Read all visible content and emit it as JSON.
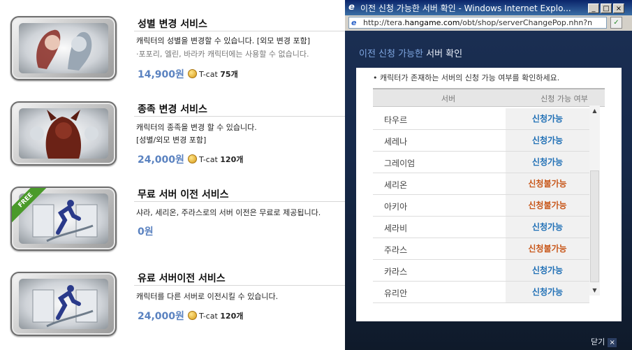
{
  "shop": {
    "items": [
      {
        "title": "성별 변경 서비스",
        "desc1": "캐릭터의 성별을 변경할 수 있습니다. [외모 변경 포함]",
        "desc2": "·포포리, 엘린, 바라카 캐릭터에는 사용할 수 없습니다.",
        "price": "14,900원",
        "tcat_label": "T-cat",
        "tcat_amount": "75개"
      },
      {
        "title": "종족 변경 서비스",
        "desc1": "캐릭터의 종족을 변경 할 수 있습니다.",
        "desc2": "[성별/외모 변경 포함]",
        "price": "24,000원",
        "tcat_label": "T-cat",
        "tcat_amount": "120개"
      },
      {
        "title": "무료 서버 이전 서비스",
        "desc1": "샤라, 세리온, 주라스로의 서버 이전은 무료로 제공됩니다.",
        "price": "0원",
        "badge": "FREE"
      },
      {
        "title": "유료 서버이전 서비스",
        "desc1": "캐릭터를 다른 서버로 이전시킬 수 있습니다.",
        "price": "24,000원",
        "tcat_label": "T-cat",
        "tcat_amount": "120개"
      }
    ]
  },
  "window": {
    "title": "이전 신청 가능한 서버 확인 - Windows Internet Explo...",
    "buttons": {
      "minimize": "_",
      "maximize": "□",
      "close": "×"
    },
    "address": {
      "prefix": "http://tera.",
      "domain": "hangame.com",
      "path": "/obt/shop/serverChangePop.nhn?n"
    }
  },
  "popup": {
    "title_highlight": "이전 신청 가능한",
    "title_rest": " 서버 확인",
    "notice": "• 캐릭터가 존재하는 서버의 신청 가능 여부를 확인하세요.",
    "columns": {
      "server": "서버",
      "status": "신청 가능 여부"
    },
    "rows": [
      {
        "server": "타우르",
        "status": "신청가능",
        "available": true
      },
      {
        "server": "세레나",
        "status": "신청가능",
        "available": true
      },
      {
        "server": "그레이엄",
        "status": "신청가능",
        "available": true
      },
      {
        "server": "세리온",
        "status": "신청불가능",
        "available": false
      },
      {
        "server": "아키아",
        "status": "신청불가능",
        "available": false
      },
      {
        "server": "세라비",
        "status": "신청가능",
        "available": true
      },
      {
        "server": "주라스",
        "status": "신청불가능",
        "available": false
      },
      {
        "server": "카라스",
        "status": "신청가능",
        "available": true
      },
      {
        "server": "유리안",
        "status": "신청가능",
        "available": true
      }
    ],
    "close_label": "닫기",
    "close_icon": "×"
  },
  "colors": {
    "available": "#1f6fb5",
    "unavailable": "#c8571a",
    "price": "#5a82c0"
  }
}
